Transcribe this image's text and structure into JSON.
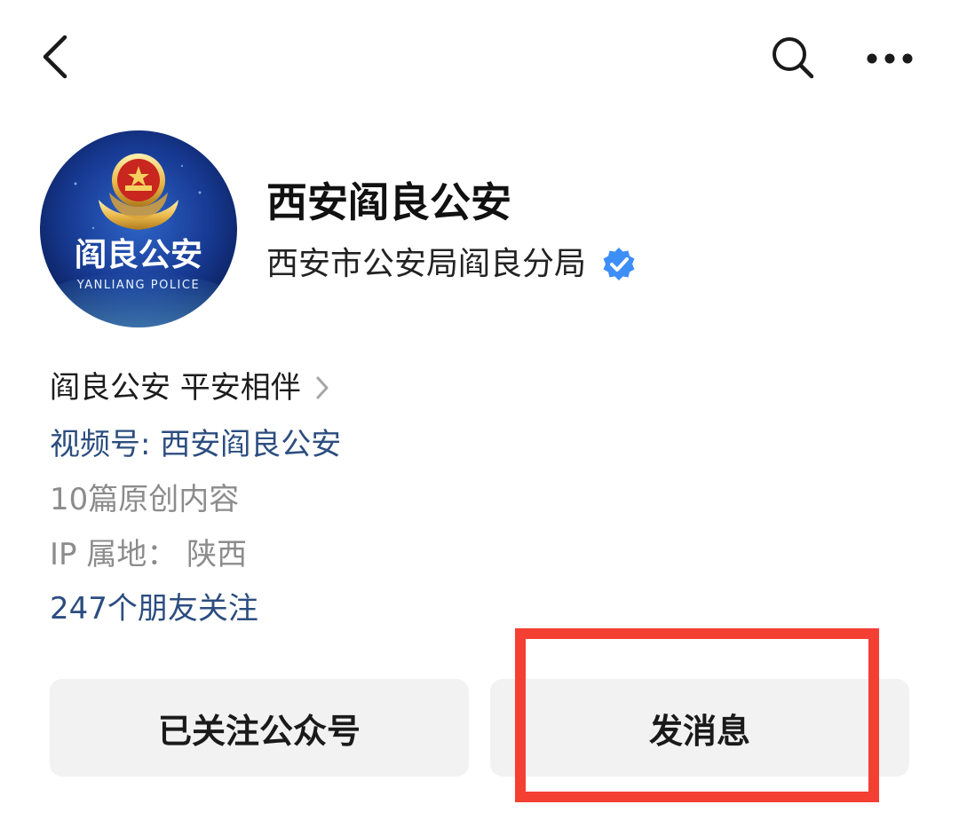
{
  "nav": {
    "back_icon": "chevron-left-icon",
    "search_icon": "search-icon",
    "more_icon": "more-dots-icon"
  },
  "profile": {
    "avatar": {
      "logo_text": "阎良公安",
      "logo_subtext": "YANLIANG POLICE"
    },
    "account_name": "西安阎良公安",
    "subject_name": "西安市公安局阎良分局",
    "verified_icon": "verified-badge-icon"
  },
  "info": {
    "intro": "阎良公安 平安相伴",
    "channel": "视频号: 西安阎良公安",
    "articles": "10篇原创内容",
    "ip_location": "IP 属地： 陕西",
    "friends_following": "247个朋友关注"
  },
  "actions": {
    "follow_label": "已关注公众号",
    "message_label": "发消息"
  },
  "colors": {
    "link_blue": "#2c4d7f",
    "secondary_gray": "#8c8c8c",
    "verified_blue": "#3d8ef7",
    "highlight_red": "#f43f33",
    "button_bg": "#f2f2f2"
  }
}
